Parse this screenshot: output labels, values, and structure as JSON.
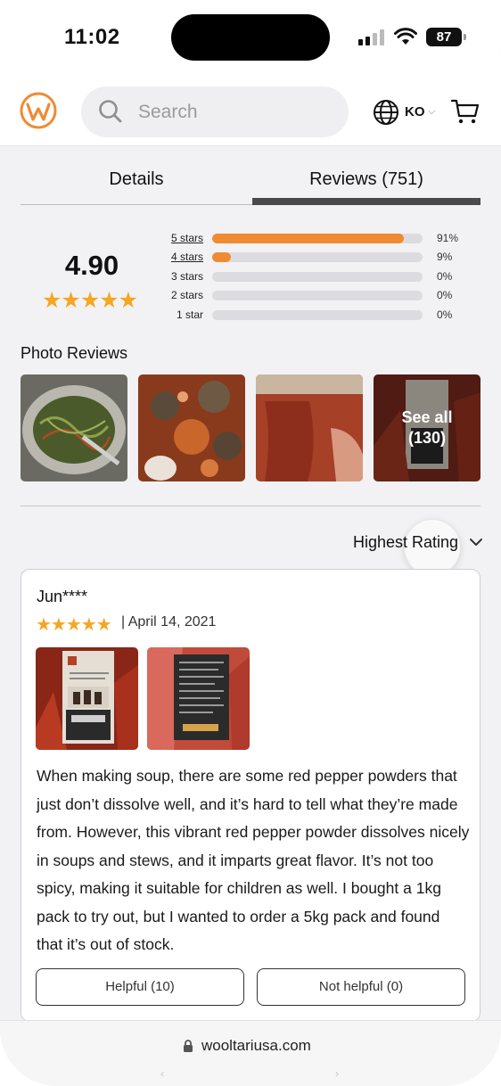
{
  "status": {
    "time": "11:02",
    "battery": "87"
  },
  "header": {
    "search_placeholder": "Search",
    "language": "KO"
  },
  "tabs": [
    {
      "label": "Details"
    },
    {
      "label": "Reviews (751)"
    }
  ],
  "summary": {
    "average": "4.90",
    "stars": "★★★★★",
    "rows": [
      {
        "label": "5 stars",
        "percent_label": "91%",
        "fraction": 0.91
      },
      {
        "label": "4 stars",
        "percent_label": "9%",
        "fraction": 0.09
      },
      {
        "label": "3 stars",
        "percent_label": "0%",
        "fraction": 0
      },
      {
        "label": "2 stars",
        "percent_label": "0%",
        "fraction": 0
      },
      {
        "label": "1 star",
        "percent_label": "0%",
        "fraction": 0
      }
    ]
  },
  "photo_reviews": {
    "title": "Photo Reviews",
    "see_all_label": "See all",
    "see_all_count": "(130)"
  },
  "sort": {
    "label": "Highest Rating"
  },
  "review": {
    "reviewer": "Jun****",
    "stars": "★★★★★",
    "date": "| April 14, 2021",
    "text": "When making soup, there are some red pepper powders that just don’t dissolve well, and it’s hard to tell what they’re made from. However, this vibrant red pepper powder dissolves nicely in soups and stews, and it imparts great flavor. It’s not too spicy, making it suitable for children as well. I bought a 1kg pack to try out, but I wanted to order a 5kg pack and found that it’s out of stock.",
    "helpful_label": "Helpful (10)",
    "not_helpful_label": "Not helpful (0)"
  },
  "browser": {
    "url": "wooltariusa.com"
  },
  "colors": {
    "accent": "#ef8b32",
    "star": "#f5a623"
  }
}
